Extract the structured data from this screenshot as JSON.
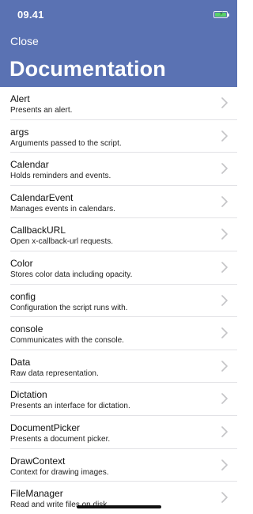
{
  "status_bar": {
    "time": "09.41"
  },
  "header": {
    "close_label": "Close",
    "title": "Documentation"
  },
  "items": [
    {
      "title": "Alert",
      "subtitle": "Presents an alert."
    },
    {
      "title": "args",
      "subtitle": "Arguments passed to the script."
    },
    {
      "title": "Calendar",
      "subtitle": "Holds reminders and events."
    },
    {
      "title": "CalendarEvent",
      "subtitle": "Manages events in calendars."
    },
    {
      "title": "CallbackURL",
      "subtitle": "Open x-callback-url requests."
    },
    {
      "title": "Color",
      "subtitle": "Stores color data including opacity."
    },
    {
      "title": "config",
      "subtitle": "Configuration the script runs with."
    },
    {
      "title": "console",
      "subtitle": "Communicates with the console."
    },
    {
      "title": "Data",
      "subtitle": "Raw data representation."
    },
    {
      "title": "Dictation",
      "subtitle": "Presents an interface for dictation."
    },
    {
      "title": "DocumentPicker",
      "subtitle": "Presents a document picker."
    },
    {
      "title": "DrawContext",
      "subtitle": "Context for drawing images."
    },
    {
      "title": "FileManager",
      "subtitle": "Read and write files on disk."
    }
  ],
  "colors": {
    "header_bg": "#5a72b3",
    "battery": "#5ad16a",
    "chevron": "#c4c4c7"
  }
}
